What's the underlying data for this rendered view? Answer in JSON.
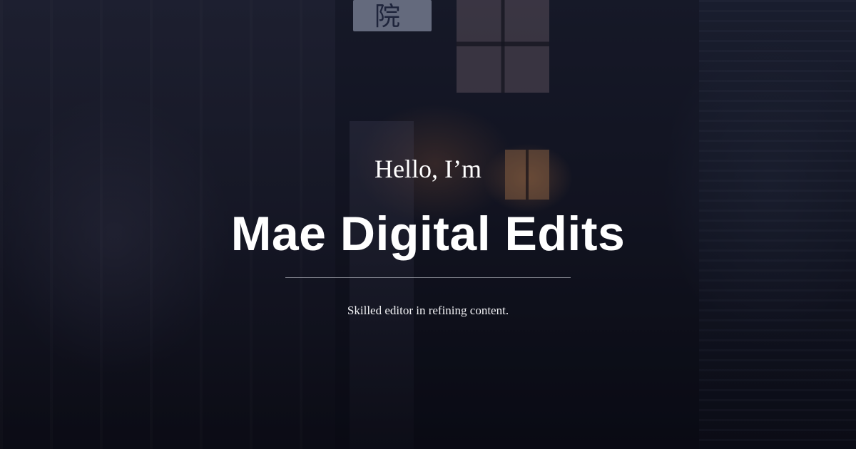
{
  "hero": {
    "greeting": "Hello, I’m",
    "name": "Mae Digital Edits",
    "tagline": "Skilled editor in refining content.",
    "sign_glyph": "院"
  },
  "colors": {
    "text": "#ffffff",
    "overlay": "#080a14",
    "divider": "#dcdee6"
  }
}
